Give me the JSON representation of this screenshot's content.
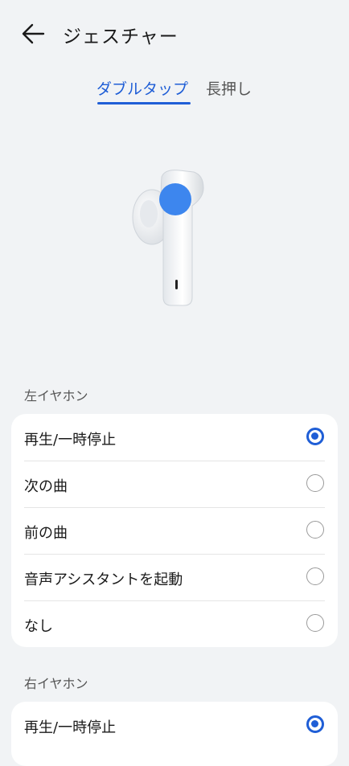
{
  "header": {
    "title": "ジェスチャー",
    "back_icon": "arrow-left-icon"
  },
  "tabs": [
    {
      "label": "ダブルタップ",
      "active": true
    },
    {
      "label": "長押し",
      "active": false
    }
  ],
  "accent_color": "#1f5ed6",
  "left_earphone": {
    "label": "左イヤホン",
    "options": [
      {
        "label": "再生/一時停止",
        "selected": true
      },
      {
        "label": "次の曲",
        "selected": false
      },
      {
        "label": "前の曲",
        "selected": false
      },
      {
        "label": "音声アシスタントを起動",
        "selected": false
      },
      {
        "label": "なし",
        "selected": false
      }
    ]
  },
  "right_earphone": {
    "label": "右イヤホン",
    "options": [
      {
        "label": "再生/一時停止",
        "selected": true
      }
    ]
  }
}
